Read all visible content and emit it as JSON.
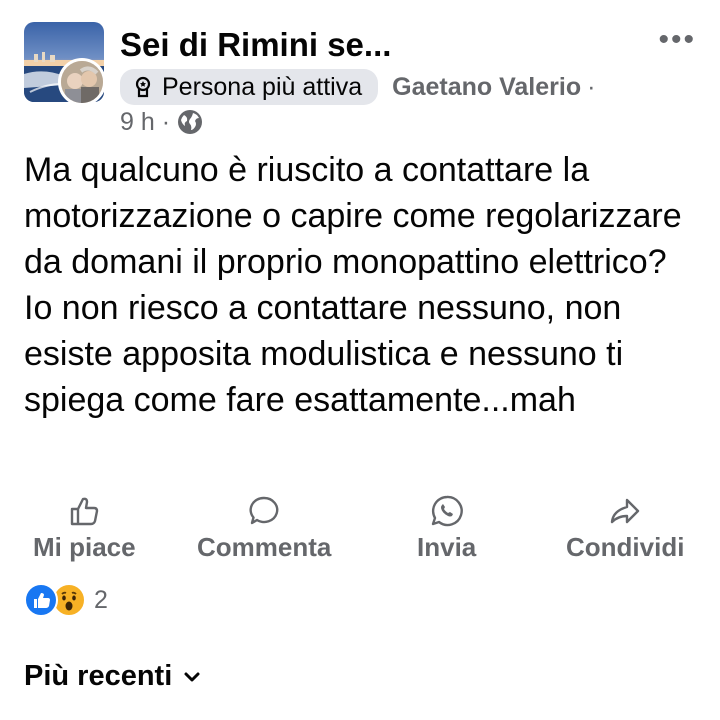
{
  "post": {
    "group_name": "Sei di Rimini se...",
    "badge_label": "Persona più attiva",
    "author": "Gaetano Valerio",
    "separator": "·",
    "time": "9 h ·",
    "text": "Ma qualcuno è riuscito a contattare la motorizzazione o capire come regolarizzare da domani il proprio monopattino elettrico? Io non riesco a contattare nessuno, non esiste apposita modulistica e nessuno ti spiega come fare esattamente...mah",
    "more_label": "•••"
  },
  "actions": {
    "like": "Mi piace",
    "comment": "Commenta",
    "send": "Invia",
    "share": "Condividi"
  },
  "reactions": {
    "count": "2",
    "types": [
      "like-icon",
      "wow-icon"
    ]
  },
  "comments": {
    "sort_label": "Più recenti"
  },
  "colors": {
    "secondary_text": "#65676b",
    "badge_bg": "#e4e6eb",
    "like_blue": "#1877f2",
    "wow_yellow": "#f7b125"
  }
}
